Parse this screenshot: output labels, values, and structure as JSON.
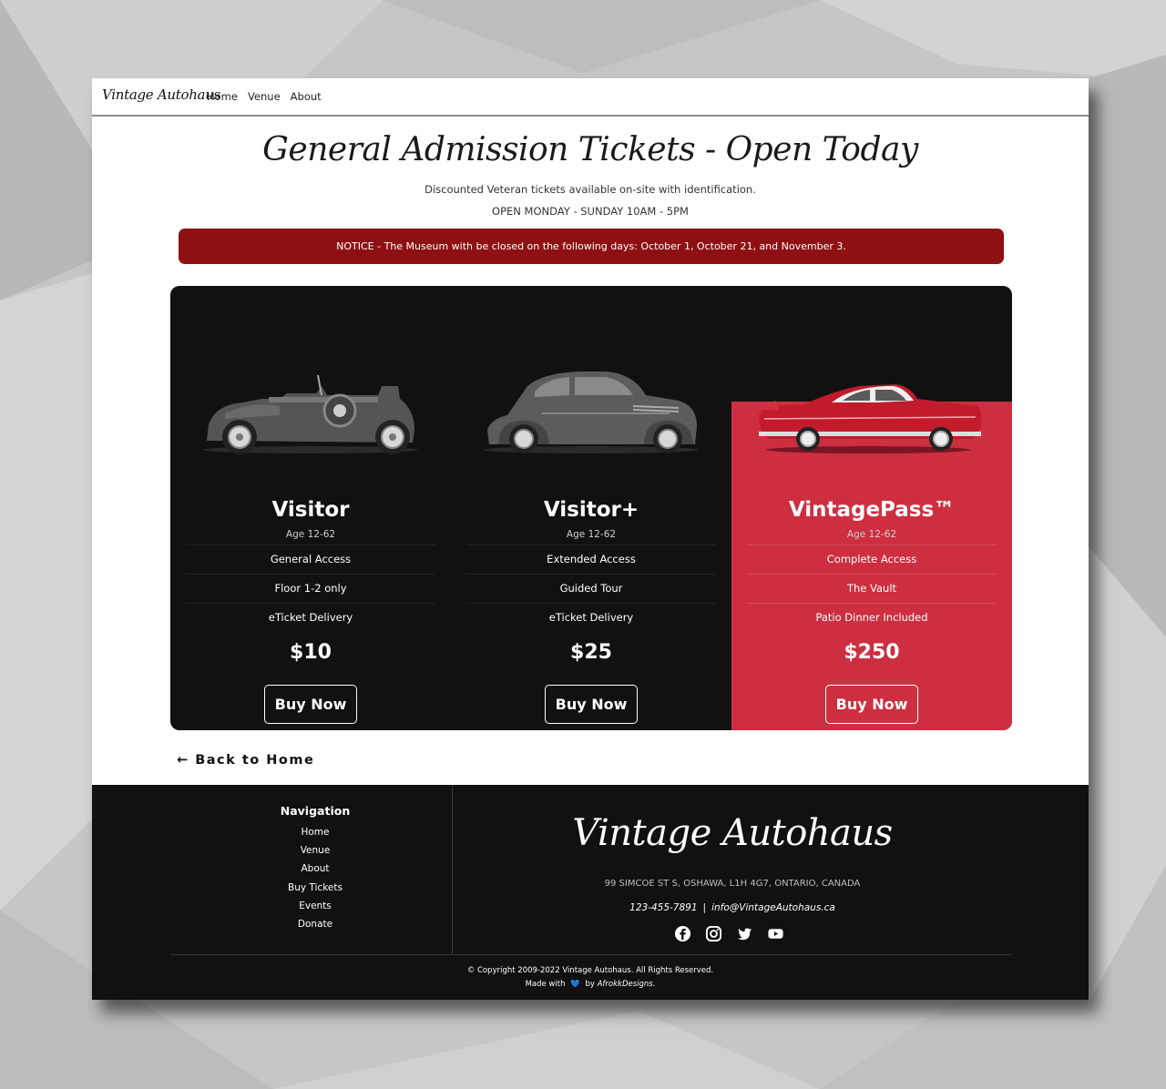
{
  "nav": {
    "brand": "Vintage Autohaus",
    "links": [
      "Home",
      "Venue",
      "About"
    ]
  },
  "hero": {
    "title": "General Admission Tickets - Open Today",
    "veteran_note": "Discounted Veteran tickets available on-site with identification.",
    "hours": "OPEN MONDAY - SUNDAY 10AM - 5PM"
  },
  "notice": "NOTICE - The Museum with be closed on the following days: October 1, October 21, and November 3.",
  "plans": [
    {
      "name": "Visitor",
      "age": "Age 12-62",
      "features": [
        "General Access",
        "Floor 1-2 only",
        "eTicket Delivery"
      ],
      "price": "$10",
      "button": "Buy Now",
      "car_icon": "vintage-roadster-icon"
    },
    {
      "name": "Visitor+",
      "age": "Age 12-62",
      "features": [
        "Extended Access",
        "Guided Tour",
        "eTicket Delivery"
      ],
      "price": "$25",
      "button": "Buy Now",
      "car_icon": "vintage-sedan-icon"
    },
    {
      "name": "VintagePass™",
      "age": "Age 12-62",
      "features": [
        "Complete Access",
        "The Vault",
        "Patio Dinner Included"
      ],
      "price": "$250",
      "button": "Buy Now",
      "car_icon": "classic-cadillac-icon"
    }
  ],
  "back_link": "← Back to Home",
  "footer": {
    "nav_title": "Navigation",
    "nav_links": [
      "Home",
      "Venue",
      "About",
      "Buy Tickets",
      "Events",
      "Donate"
    ],
    "brand": "Vintage Autohaus",
    "address": "99 SIMCOE ST S, OSHAWA, L1H 4G7, ONTARIO, CANADA",
    "phone": "123-455-7891",
    "separator": "|",
    "email": "info@VintageAutohaus.ca",
    "socials": [
      "facebook-icon",
      "instagram-icon",
      "twitter-icon",
      "youtube-icon"
    ],
    "copyright": "© Copyright 2009-2022 Vintage Autohaus. All Rights Reserved.",
    "made_with_prefix": "Made with",
    "made_with_heart": "💙",
    "made_with_by": "by",
    "made_with_author": "AfrokkDesigns."
  },
  "colors": {
    "notice_bg": "#8e1012",
    "panel_bg": "#111111",
    "featured_bg": "#cd2f41",
    "footer_bg": "#111111"
  }
}
